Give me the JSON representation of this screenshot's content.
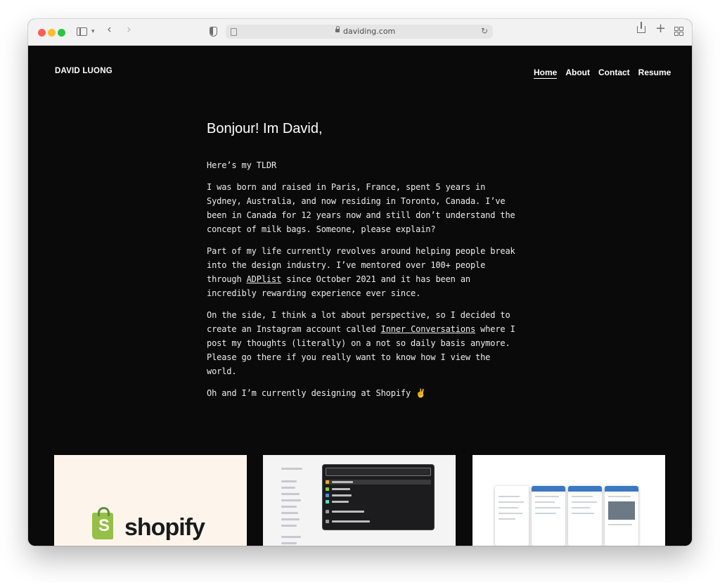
{
  "browser": {
    "url": "daviding.com",
    "icons": [
      "sidebar-icon",
      "chevron-down-icon",
      "back-icon",
      "forward-icon",
      "shield-icon",
      "page-icon",
      "lock-icon",
      "reload-icon",
      "share-icon",
      "plus-icon",
      "tab-grid-icon"
    ]
  },
  "site": {
    "brand": "DAVID LUONG",
    "nav": [
      {
        "label": "Home",
        "active": true
      },
      {
        "label": "About",
        "active": false
      },
      {
        "label": "Contact",
        "active": false
      },
      {
        "label": "Resume",
        "active": false
      }
    ],
    "greeting": "Bonjour! Im David,",
    "tldr": "Here’s my TLDR",
    "p1": "I was born and raised in Paris, France, spent 5 years in Sydney, Australia, and now residing in Toronto, Canada. I’ve been in Canada for 12 years now and still don’t understand the concept of milk bags. Someone, please explain?",
    "p2_before": "Part of my life currently revolves around helping people break into the design industry. I’ve mentored over 100+ people through ",
    "p2_link": "ADPlist",
    "p2_after": " since October 2021 and it has been an incredibly rewarding experience ever since.",
    "p3_before": "On the side, I think a lot about perspective, so I decided to create an Instagram account called ",
    "p3_link": "Inner Conversations",
    "p3_after": " where I post my thoughts (literally) on a not so daily basis anymore. Please go there if you really want to know how I view the world.",
    "p4": "Oh and I’m currently designing at Shopify ✌️",
    "card1_logo": "shopify"
  }
}
